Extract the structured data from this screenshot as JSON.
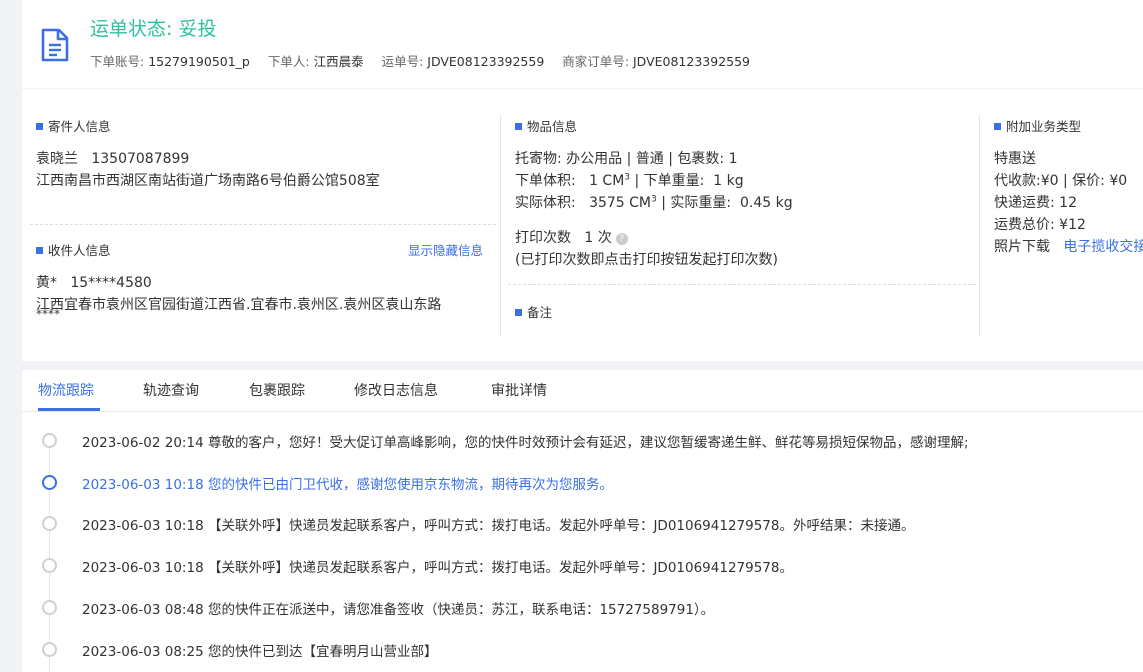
{
  "header": {
    "status_label": "运单状态:",
    "status_value": "妥投",
    "account_label": "下单账号:",
    "account_value": "15279190501_p",
    "orderer_label": "下单人:",
    "orderer_value": "江西晨泰",
    "waybill_label": "运单号:",
    "waybill_value": "JDVE08123392559",
    "merchant_order_label": "商家订单号:",
    "merchant_order_value": "JDVE08123392559"
  },
  "sender": {
    "title": "寄件人信息",
    "name": "袁晓兰",
    "phone": "13507087899",
    "address": "江西南昌市西湖区南站街道广场南路6号伯爵公馆508室"
  },
  "receiver": {
    "title": "收件人信息",
    "show_hidden_link": "显示隐藏信息",
    "name": "黄*",
    "phone": "15****4580",
    "address_line1": "江西宜春市袁州区官园街道江西省.宜春市.袁州区.袁州区袁山东路",
    "address_line2": "****"
  },
  "goods": {
    "title": "物品信息",
    "consignment_label": "托寄物:",
    "consignment_value": "办公用品 | 普通 | 包裹数: 1",
    "order_volume_label": "下单体积:",
    "order_volume_value": "1 CM",
    "order_weight_label": "下单重量:",
    "order_weight_value": "1 kg",
    "actual_volume_label": "实际体积:",
    "actual_volume_value": "3575 CM",
    "actual_weight_label": "实际重量:",
    "actual_weight_value": "0.45 kg",
    "cube_sup": "3",
    "separator": "|",
    "print_label": "打印次数",
    "print_value": "1 次",
    "help_icon_text": "?",
    "print_note": "(已打印次数即点击打印按钮发起打印次数)"
  },
  "remark": {
    "title": "备注"
  },
  "service": {
    "title": "附加业务类型",
    "type": "特惠送",
    "cod_label": "代收款:",
    "cod_value": "¥0",
    "insured_label": "保价:",
    "insured_value": "¥0",
    "express_fee_label": "快递运费:",
    "express_fee_value": "12",
    "total_fee_label": "运费总价:",
    "total_fee_value": "¥12",
    "photo_label": "照片下载",
    "photo_link": "电子揽收交接单"
  },
  "tabs": [
    {
      "label": "物流跟踪",
      "active": true
    },
    {
      "label": "轨迹查询",
      "active": false
    },
    {
      "label": "包裹跟踪",
      "active": false
    },
    {
      "label": "修改日志信息",
      "active": false
    },
    {
      "label": "审批详情",
      "active": false
    }
  ],
  "timeline": [
    {
      "time": "2023-06-02 20:14",
      "text": "尊敬的客户，您好！受大促订单高峰影响，您的快件时效预计会有延迟，建议您暂缓寄递生鲜、鲜花等易损短保物品，感谢理解;",
      "active": false
    },
    {
      "time": "2023-06-03 10:18",
      "text": "您的快件已由门卫代收，感谢您使用京东物流，期待再次为您服务。",
      "active": true
    },
    {
      "time": "2023-06-03 10:18",
      "text": "【关联外呼】快递员发起联系客户，呼叫方式：拨打电话。发起外呼单号：JD0106941279578。外呼结果：未接通。",
      "active": false
    },
    {
      "time": "2023-06-03 10:18",
      "text": "【关联外呼】快递员发起联系客户，呼叫方式：拨打电话。发起外呼单号：JD0106941279578。",
      "active": false
    },
    {
      "time": "2023-06-03 08:48",
      "text": "您的快件正在派送中，请您准备签收（快递员：苏江，联系电话：15727589791）。",
      "active": false
    },
    {
      "time": "2023-06-03 08:25",
      "text": "您的快件已到达【宜春明月山营业部】",
      "active": false
    }
  ],
  "colors": {
    "accent": "#3b6fe6",
    "status_green": "#2dc2a0"
  }
}
